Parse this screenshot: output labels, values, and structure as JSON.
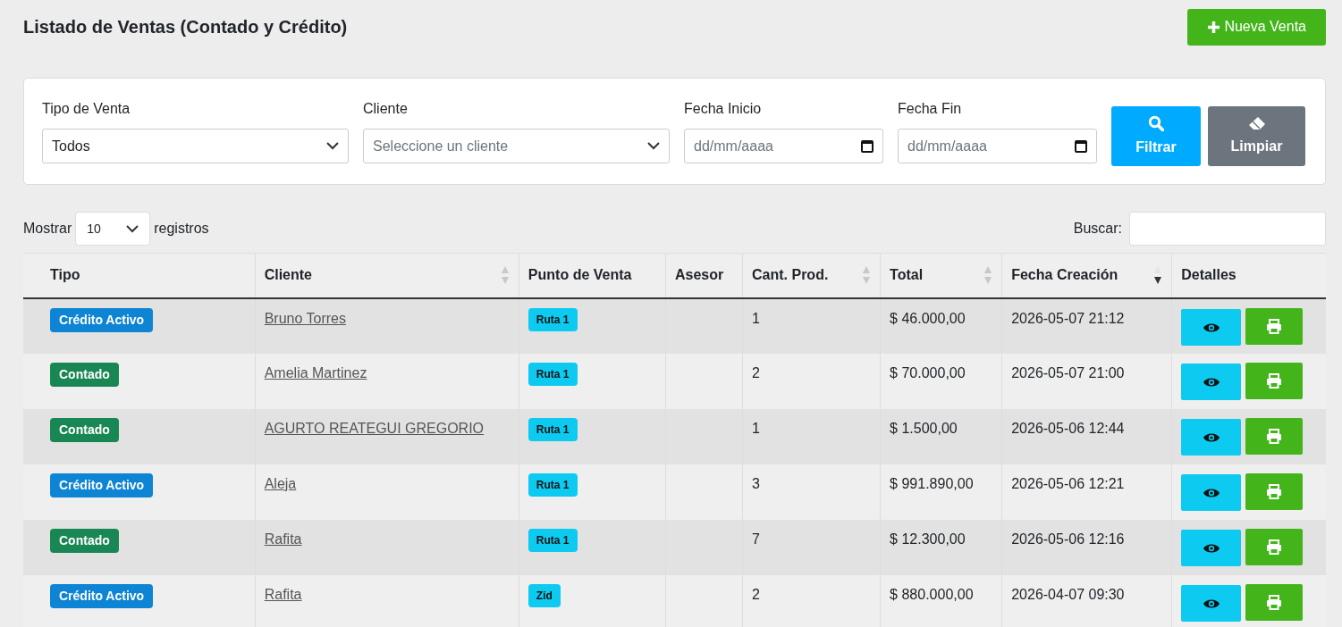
{
  "page": {
    "title": "Listado de Ventas (Contado y Crédito)",
    "new_button": "Nueva Venta"
  },
  "filters": {
    "fields": [
      {
        "kind": "select",
        "label": "Tipo de Venta",
        "value": "Todos"
      },
      {
        "kind": "select",
        "label": "Cliente",
        "placeholder": "Seleccione un cliente"
      },
      {
        "kind": "date",
        "label": "Fecha Inicio",
        "placeholder": "dd/mm/aaaa"
      },
      {
        "kind": "date",
        "label": "Fecha Fin",
        "placeholder": "dd/mm/aaaa"
      }
    ],
    "buttons": [
      {
        "kind": "filter",
        "label": "Filtrar"
      },
      {
        "kind": "clear",
        "label": "Limpiar"
      }
    ]
  },
  "length": {
    "prefix": "Mostrar",
    "value": "10",
    "suffix": "registros"
  },
  "search": {
    "label": "Buscar:"
  },
  "table": {
    "columns": [
      {
        "label": "Tipo",
        "sortable": false,
        "sorted": false
      },
      {
        "label": "Cliente",
        "sortable": true,
        "sorted": false
      },
      {
        "label": "Punto de Venta",
        "sortable": false,
        "sorted": false
      },
      {
        "label": "Asesor",
        "sortable": false,
        "sorted": false
      },
      {
        "label": "Cant. Prod.",
        "sortable": true,
        "sorted": false
      },
      {
        "label": "Total",
        "sortable": true,
        "sorted": false
      },
      {
        "label": "Fecha Creación",
        "sortable": true,
        "sorted": true
      },
      {
        "label": "Detalles",
        "sortable": false,
        "sorted": false
      }
    ],
    "rows": [
      {
        "tipo": {
          "kind": "credit",
          "label": "Crédito Activo"
        },
        "cliente": "Bruno Torres",
        "punto": "Ruta 1",
        "cant": "1",
        "total": "$ 46.000,00",
        "fecha": "2026-05-07 21:12"
      },
      {
        "tipo": {
          "kind": "cash",
          "label": "Contado"
        },
        "cliente": "Amelia Martinez",
        "punto": "Ruta 1",
        "cant": "2",
        "total": "$ 70.000,00",
        "fecha": "2026-05-07 21:00"
      },
      {
        "tipo": {
          "kind": "cash",
          "label": "Contado"
        },
        "cliente": "AGURTO REATEGUI GREGORIO",
        "punto": "Ruta 1",
        "cant": "1",
        "total": "$ 1.500,00",
        "fecha": "2026-05-06 12:44"
      },
      {
        "tipo": {
          "kind": "credit",
          "label": "Crédito Activo"
        },
        "cliente": "Aleja",
        "punto": "Ruta 1",
        "cant": "3",
        "total": "$ 991.890,00",
        "fecha": "2026-05-06 12:21"
      },
      {
        "tipo": {
          "kind": "cash",
          "label": "Contado"
        },
        "cliente": "Rafita",
        "punto": "Ruta 1",
        "cant": "7",
        "total": "$ 12.300,00",
        "fecha": "2026-05-06 12:16"
      },
      {
        "tipo": {
          "kind": "credit",
          "label": "Crédito Activo"
        },
        "cliente": "Rafita",
        "punto": "Zid",
        "cant": "2",
        "total": "$ 880.000,00",
        "fecha": "2026-04-07 09:30"
      }
    ]
  }
}
